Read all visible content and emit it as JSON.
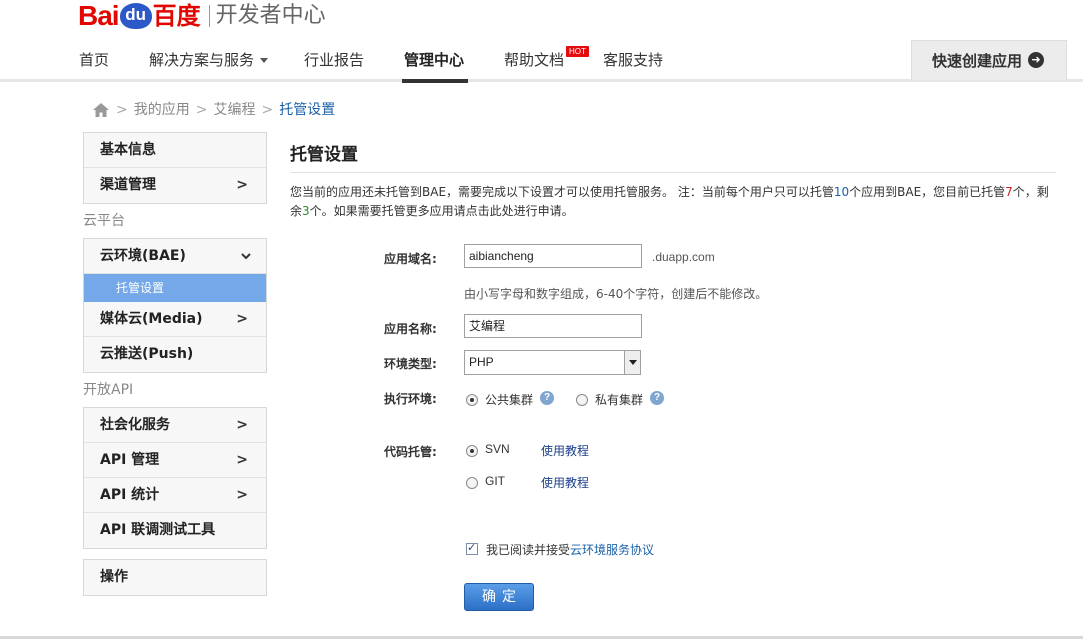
{
  "header": {
    "logo": {
      "bai": "Bai",
      "du": "du",
      "baidu_cn": "百度",
      "subtitle": "开发者中心"
    },
    "nav": [
      {
        "label": "首页"
      },
      {
        "label": "解决方案与服务"
      },
      {
        "label": "行业报告"
      },
      {
        "label": "管理中心"
      },
      {
        "label": "帮助文档",
        "badge": "HOT"
      },
      {
        "label": "客服支持"
      }
    ],
    "quick_create": "快速创建应用"
  },
  "breadcrumb": {
    "items": [
      "我的应用",
      "艾编程"
    ],
    "current": "托管设置",
    "separator": ">"
  },
  "sidebar": {
    "group1": [
      "基本信息",
      "渠道管理"
    ],
    "section_cloud": "云平台",
    "cloud_items": [
      {
        "label": "云环境(BAE)"
      },
      {
        "label": "托管设置"
      },
      {
        "label": "媒体云(Media)"
      },
      {
        "label": "云推送(Push)"
      }
    ],
    "section_api": "开放API",
    "api_items": [
      "社会化服务",
      "API 管理",
      "API 统计",
      "API 联调测试工具"
    ],
    "ops": "操作"
  },
  "main": {
    "title": "托管设置",
    "notice": {
      "part1": "您当前的应用还未托管到BAE，需要完成以下设置才可以使用托管服务。 注：当前每个用户只可以托管",
      "max_apps": "10",
      "part2": "个应用到BAE，您目前已托管",
      "hosted": "7",
      "part3": "个，剩余",
      "remaining": "3",
      "part4": "个。如果需要托管更多应用请点击此处进行申请。"
    },
    "form": {
      "domain_label": "应用域名:",
      "domain_value": "aibiancheng",
      "domain_suffix": ".duapp.com",
      "domain_hint": "由小写字母和数字组成，6-40个字符，创建后不能修改。",
      "name_label": "应用名称:",
      "name_value": "艾编程",
      "env_type_label": "环境类型:",
      "env_type_value": "PHP",
      "exec_env_label": "执行环境:",
      "exec_public": "公共集群",
      "exec_private": "私有集群",
      "code_label": "代码托管:",
      "svn": "SVN",
      "git": "GIT",
      "tutorial": "使用教程",
      "agree_prefix": "我已阅读并接受",
      "agree_link": "云环境服务协议",
      "confirm": "确定"
    }
  },
  "colors": {
    "brand_red": "#e10601",
    "brand_blue": "#2d59c8",
    "link_blue": "#1a61a8",
    "active_sub": "#75a8e8",
    "button_blue": "#2c6fc6"
  }
}
